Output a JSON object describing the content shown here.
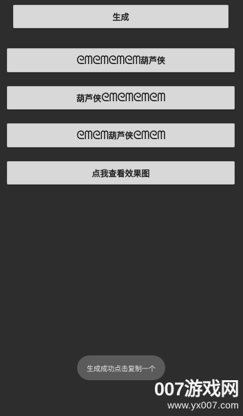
{
  "generate_button": {
    "label": "生成"
  },
  "result_rows": [
    {
      "prefix": "",
      "name": "葫芦侠",
      "suffix": "",
      "deco_before": "ᘓᗰᘓᗰᘓᗰᘓᗰ",
      "deco_after": ""
    },
    {
      "prefix": "",
      "name": "葫芦侠",
      "suffix": "",
      "deco_before": "",
      "deco_after": "ᘓᗰᘓᗰᘓᗰᘓᗰ"
    },
    {
      "prefix": "",
      "name": "葫芦侠",
      "suffix": "",
      "deco_before": "ᘓᗰᘓᗰ",
      "deco_after": "ᘓᗰᘓᗰ"
    }
  ],
  "preview_button": {
    "label": "点我查看效果图"
  },
  "toast": {
    "text": "生成成功点击复制一个"
  },
  "watermark": {
    "main": "007游戏网",
    "sub": "www.yx007.com"
  }
}
